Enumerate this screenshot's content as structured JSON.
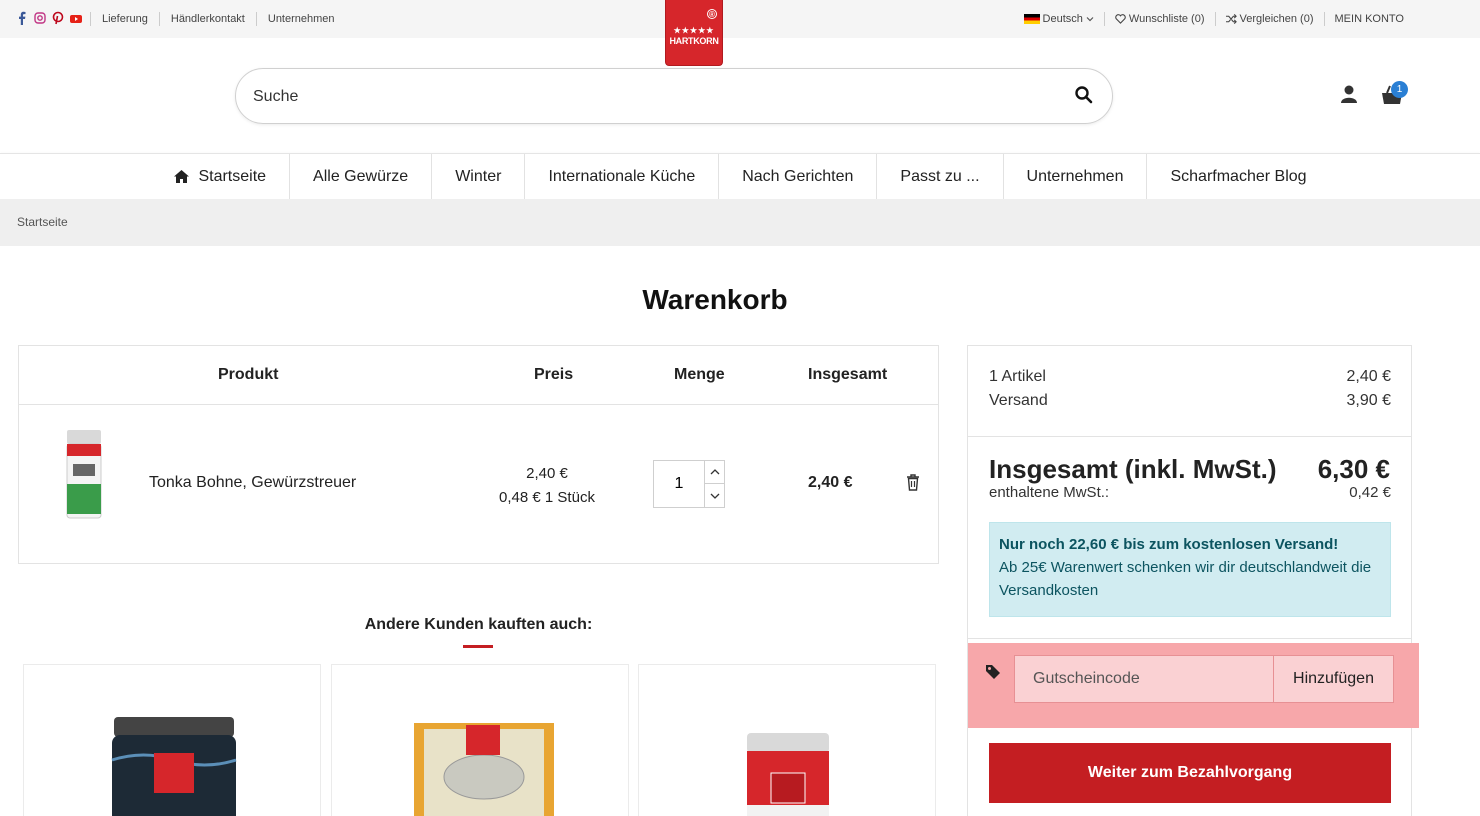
{
  "topbar": {
    "social_icons": [
      "facebook-icon",
      "instagram-icon",
      "pinterest-icon",
      "youtube-icon"
    ],
    "links": [
      "Lieferung",
      "Händlerkontakt",
      "Unternehmen"
    ],
    "language": "Deutsch",
    "wishlist": "Wunschliste (0)",
    "compare": "Vergleichen (0)",
    "account": "MEIN KONTO"
  },
  "logo": {
    "text": "HARTKORN"
  },
  "search": {
    "placeholder": "Suche"
  },
  "cart": {
    "badge": "1"
  },
  "nav": {
    "items": [
      "Startseite",
      "Alle Gewürze",
      "Winter",
      "Internationale Küche",
      "Nach Gerichten",
      "Passt zu ...",
      "Unternehmen",
      "Scharfmacher Blog"
    ]
  },
  "breadcrumb": {
    "items": [
      "Startseite"
    ]
  },
  "page": {
    "title": "Warenkorb"
  },
  "cart_table": {
    "headers": {
      "product": "Produkt",
      "price": "Preis",
      "quantity": "Menge",
      "total": "Insgesamt"
    },
    "rows": [
      {
        "name": "Tonka Bohne, Gewürzstreuer",
        "price": "2,40 €",
        "unit_price": "0,48 € 1 Stück",
        "quantity": "1",
        "total": "2,40 €"
      }
    ]
  },
  "also_bought": {
    "title": "Andere Kunden kauften auch:"
  },
  "summary": {
    "items_label": "1 Artikel",
    "items_value": "2,40 €",
    "shipping_label": "Versand",
    "shipping_value": "3,90 €",
    "total_label": "Insgesamt (inkl. MwSt.)",
    "total_value": "6,30 €",
    "vat_label": "enthaltene MwSt.:",
    "vat_value": "0,42 €",
    "info_title": "Nur noch 22,60 € bis zum kostenlosen Versand!",
    "info_text": "Ab 25€ Warenwert schenken wir dir deutschlandweit die Versandkosten",
    "coupon_placeholder": "Gutscheincode",
    "coupon_button": "Hinzufügen",
    "checkout_button": "Weiter zum Bezahlvorgang"
  },
  "colors": {
    "brand_red": "#c41e22",
    "info_bg": "#d1ecf1",
    "highlight": "#f7a7aa",
    "badge_blue": "#2a7fd4"
  }
}
